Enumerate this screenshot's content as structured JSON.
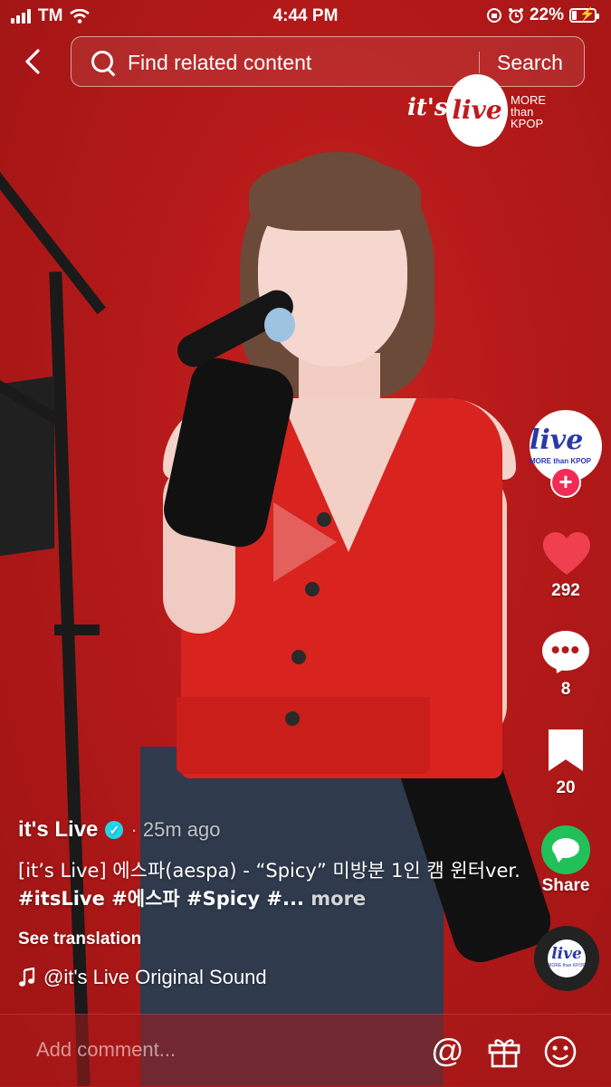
{
  "status_bar": {
    "carrier": "TM",
    "time": "4:44 PM",
    "battery_percent": "22%",
    "battery_level": 0.22
  },
  "search": {
    "placeholder": "Find related content",
    "button_label": "Search"
  },
  "watermark": {
    "its": "it's",
    "live": "live",
    "more": "MORE",
    "than": "than",
    "kpop": "KPOP"
  },
  "actions": {
    "likes": "292",
    "comments": "8",
    "saves": "20",
    "share_label": "Share",
    "avatar_logo": "live",
    "avatar_sub": "MORE than KPOP",
    "disc_logo": "live",
    "disc_sub": "MORE than KPOP"
  },
  "post": {
    "author": "it's Live",
    "time_ago": "· 25m ago",
    "description": "[it’s Live] 에스파(aespa) - “Spicy” 미방분 1인 캠 윈터ver. ",
    "hashtags": "#itsLive #에스파 #Spicy #...",
    "more_label": " more",
    "see_translation": "See translation",
    "sound": "@it's Live Original Sound"
  },
  "comment_bar": {
    "placeholder": "Add comment..."
  },
  "icons": [
    "back-icon",
    "search-icon",
    "heart-icon",
    "comment-icon",
    "bookmark-icon",
    "share-icon",
    "music-note-icon",
    "mention-icon",
    "gift-icon",
    "emoji-icon",
    "verified-icon",
    "follow-plus-icon"
  ]
}
